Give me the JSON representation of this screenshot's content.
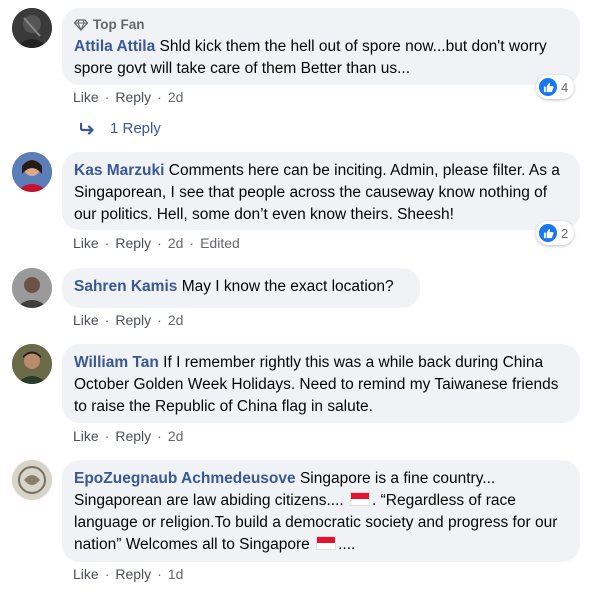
{
  "comments": [
    {
      "badge": "Top Fan",
      "author": "Attila Attila",
      "text": "Shld kick them the hell out of spore now...but don't worry spore govt will take care of them Better than us...",
      "like": "Like",
      "reply": "Reply",
      "time": "2d",
      "reaction_count": "4"
    },
    {
      "author": "Kas Marzuki",
      "text": "Comments here can be inciting. Admin, please filter. As a Singaporean, I see that people across the causeway know nothing of our politics. Hell, some don’t even know theirs. Sheesh!",
      "like": "Like",
      "reply": "Reply",
      "time": "2d",
      "edited": "Edited",
      "reaction_count": "2"
    },
    {
      "author": "Sahren Kamis",
      "text": "May I know the exact location?",
      "like": "Like",
      "reply": "Reply",
      "time": "2d"
    },
    {
      "author": "William Tan",
      "text": "If I remember rightly this was a while back during China October Golden Week Holidays. Need to remind my Taiwanese friends to raise the Republic of China flag in salute.",
      "like": "Like",
      "reply": "Reply",
      "time": "2d"
    },
    {
      "author": "EpoZuegnaub Achmedeusove",
      "text_part1": "Singapore is a fine country... Singaporean are law abiding citizens.... ",
      "text_part2": ". “Regardless of race language or religion.To build a democratic society and progress for our nation” Welcomes all to Singapore ",
      "text_part3": "....",
      "like": "Like",
      "reply": "Reply",
      "time": "1d"
    }
  ],
  "view_replies": "1 Reply",
  "icons": {
    "top_fan": "diamond-icon",
    "reply_arrow": "reply-arrow-icon",
    "like_reaction": "thumbs-up-icon",
    "flag": "singapore-flag-emoji"
  },
  "colors": {
    "author": "#385898",
    "bubble": "#f0f2f5",
    "meta": "#65676b",
    "like_blue": "#1877f2"
  }
}
